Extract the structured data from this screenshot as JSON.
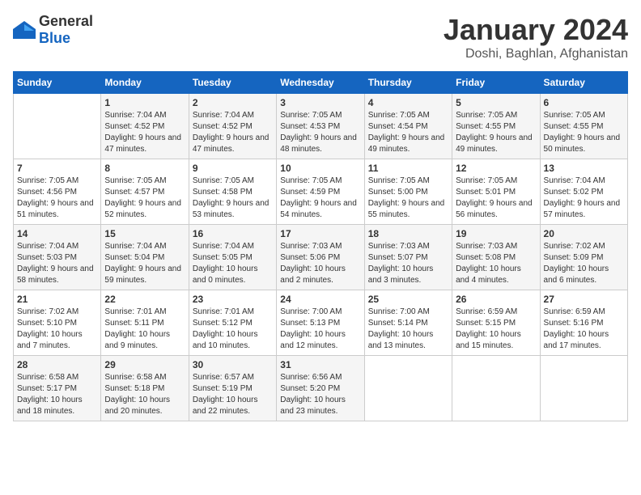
{
  "logo": {
    "general": "General",
    "blue": "Blue"
  },
  "header": {
    "month": "January 2024",
    "location": "Doshi, Baghlan, Afghanistan"
  },
  "weekdays": [
    "Sunday",
    "Monday",
    "Tuesday",
    "Wednesday",
    "Thursday",
    "Friday",
    "Saturday"
  ],
  "weeks": [
    [
      {
        "day": "",
        "sunrise": "",
        "sunset": "",
        "daylight": ""
      },
      {
        "day": "1",
        "sunrise": "Sunrise: 7:04 AM",
        "sunset": "Sunset: 4:52 PM",
        "daylight": "Daylight: 9 hours and 47 minutes."
      },
      {
        "day": "2",
        "sunrise": "Sunrise: 7:04 AM",
        "sunset": "Sunset: 4:52 PM",
        "daylight": "Daylight: 9 hours and 47 minutes."
      },
      {
        "day": "3",
        "sunrise": "Sunrise: 7:05 AM",
        "sunset": "Sunset: 4:53 PM",
        "daylight": "Daylight: 9 hours and 48 minutes."
      },
      {
        "day": "4",
        "sunrise": "Sunrise: 7:05 AM",
        "sunset": "Sunset: 4:54 PM",
        "daylight": "Daylight: 9 hours and 49 minutes."
      },
      {
        "day": "5",
        "sunrise": "Sunrise: 7:05 AM",
        "sunset": "Sunset: 4:55 PM",
        "daylight": "Daylight: 9 hours and 49 minutes."
      },
      {
        "day": "6",
        "sunrise": "Sunrise: 7:05 AM",
        "sunset": "Sunset: 4:55 PM",
        "daylight": "Daylight: 9 hours and 50 minutes."
      }
    ],
    [
      {
        "day": "7",
        "sunrise": "Sunrise: 7:05 AM",
        "sunset": "Sunset: 4:56 PM",
        "daylight": "Daylight: 9 hours and 51 minutes."
      },
      {
        "day": "8",
        "sunrise": "Sunrise: 7:05 AM",
        "sunset": "Sunset: 4:57 PM",
        "daylight": "Daylight: 9 hours and 52 minutes."
      },
      {
        "day": "9",
        "sunrise": "Sunrise: 7:05 AM",
        "sunset": "Sunset: 4:58 PM",
        "daylight": "Daylight: 9 hours and 53 minutes."
      },
      {
        "day": "10",
        "sunrise": "Sunrise: 7:05 AM",
        "sunset": "Sunset: 4:59 PM",
        "daylight": "Daylight: 9 hours and 54 minutes."
      },
      {
        "day": "11",
        "sunrise": "Sunrise: 7:05 AM",
        "sunset": "Sunset: 5:00 PM",
        "daylight": "Daylight: 9 hours and 55 minutes."
      },
      {
        "day": "12",
        "sunrise": "Sunrise: 7:05 AM",
        "sunset": "Sunset: 5:01 PM",
        "daylight": "Daylight: 9 hours and 56 minutes."
      },
      {
        "day": "13",
        "sunrise": "Sunrise: 7:04 AM",
        "sunset": "Sunset: 5:02 PM",
        "daylight": "Daylight: 9 hours and 57 minutes."
      }
    ],
    [
      {
        "day": "14",
        "sunrise": "Sunrise: 7:04 AM",
        "sunset": "Sunset: 5:03 PM",
        "daylight": "Daylight: 9 hours and 58 minutes."
      },
      {
        "day": "15",
        "sunrise": "Sunrise: 7:04 AM",
        "sunset": "Sunset: 5:04 PM",
        "daylight": "Daylight: 9 hours and 59 minutes."
      },
      {
        "day": "16",
        "sunrise": "Sunrise: 7:04 AM",
        "sunset": "Sunset: 5:05 PM",
        "daylight": "Daylight: 10 hours and 0 minutes."
      },
      {
        "day": "17",
        "sunrise": "Sunrise: 7:03 AM",
        "sunset": "Sunset: 5:06 PM",
        "daylight": "Daylight: 10 hours and 2 minutes."
      },
      {
        "day": "18",
        "sunrise": "Sunrise: 7:03 AM",
        "sunset": "Sunset: 5:07 PM",
        "daylight": "Daylight: 10 hours and 3 minutes."
      },
      {
        "day": "19",
        "sunrise": "Sunrise: 7:03 AM",
        "sunset": "Sunset: 5:08 PM",
        "daylight": "Daylight: 10 hours and 4 minutes."
      },
      {
        "day": "20",
        "sunrise": "Sunrise: 7:02 AM",
        "sunset": "Sunset: 5:09 PM",
        "daylight": "Daylight: 10 hours and 6 minutes."
      }
    ],
    [
      {
        "day": "21",
        "sunrise": "Sunrise: 7:02 AM",
        "sunset": "Sunset: 5:10 PM",
        "daylight": "Daylight: 10 hours and 7 minutes."
      },
      {
        "day": "22",
        "sunrise": "Sunrise: 7:01 AM",
        "sunset": "Sunset: 5:11 PM",
        "daylight": "Daylight: 10 hours and 9 minutes."
      },
      {
        "day": "23",
        "sunrise": "Sunrise: 7:01 AM",
        "sunset": "Sunset: 5:12 PM",
        "daylight": "Daylight: 10 hours and 10 minutes."
      },
      {
        "day": "24",
        "sunrise": "Sunrise: 7:00 AM",
        "sunset": "Sunset: 5:13 PM",
        "daylight": "Daylight: 10 hours and 12 minutes."
      },
      {
        "day": "25",
        "sunrise": "Sunrise: 7:00 AM",
        "sunset": "Sunset: 5:14 PM",
        "daylight": "Daylight: 10 hours and 13 minutes."
      },
      {
        "day": "26",
        "sunrise": "Sunrise: 6:59 AM",
        "sunset": "Sunset: 5:15 PM",
        "daylight": "Daylight: 10 hours and 15 minutes."
      },
      {
        "day": "27",
        "sunrise": "Sunrise: 6:59 AM",
        "sunset": "Sunset: 5:16 PM",
        "daylight": "Daylight: 10 hours and 17 minutes."
      }
    ],
    [
      {
        "day": "28",
        "sunrise": "Sunrise: 6:58 AM",
        "sunset": "Sunset: 5:17 PM",
        "daylight": "Daylight: 10 hours and 18 minutes."
      },
      {
        "day": "29",
        "sunrise": "Sunrise: 6:58 AM",
        "sunset": "Sunset: 5:18 PM",
        "daylight": "Daylight: 10 hours and 20 minutes."
      },
      {
        "day": "30",
        "sunrise": "Sunrise: 6:57 AM",
        "sunset": "Sunset: 5:19 PM",
        "daylight": "Daylight: 10 hours and 22 minutes."
      },
      {
        "day": "31",
        "sunrise": "Sunrise: 6:56 AM",
        "sunset": "Sunset: 5:20 PM",
        "daylight": "Daylight: 10 hours and 23 minutes."
      },
      {
        "day": "",
        "sunrise": "",
        "sunset": "",
        "daylight": ""
      },
      {
        "day": "",
        "sunrise": "",
        "sunset": "",
        "daylight": ""
      },
      {
        "day": "",
        "sunrise": "",
        "sunset": "",
        "daylight": ""
      }
    ]
  ]
}
